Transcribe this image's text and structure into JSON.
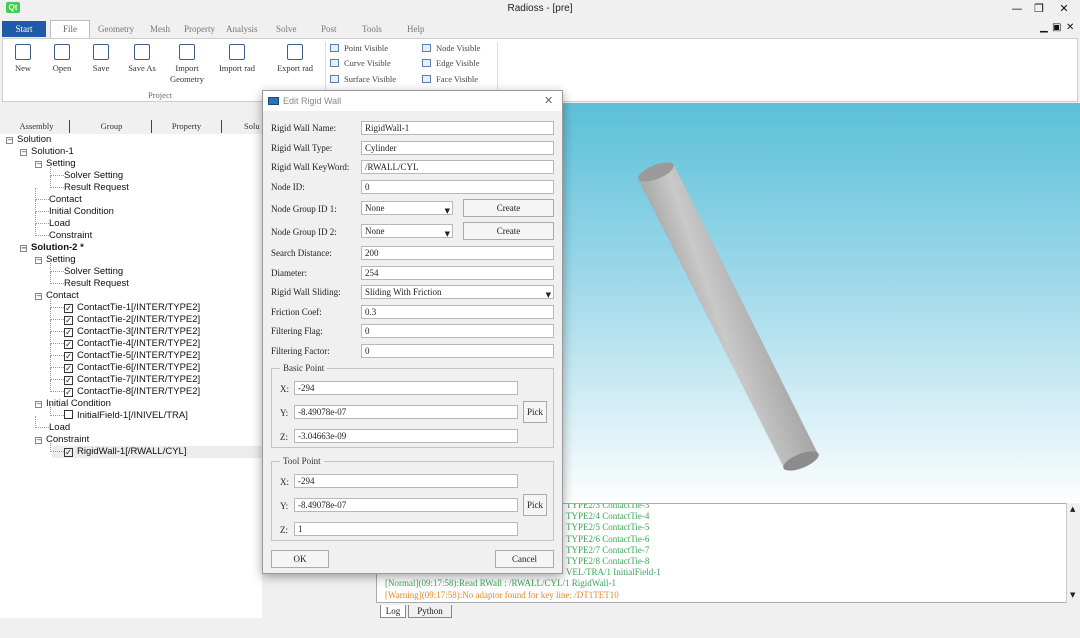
{
  "window": {
    "title": "Radioss - [pre]",
    "qt_logo": "Qt"
  },
  "menu": {
    "start": "Start",
    "file": "File",
    "items": [
      "Geometry",
      "Mesh",
      "Property",
      "Analysis",
      "Solve",
      "Post",
      "Tools",
      "Help"
    ]
  },
  "ribbon": {
    "buttons": [
      {
        "label": "New",
        "icon": "new-file-icon"
      },
      {
        "label": "Open",
        "icon": "folder-open-icon"
      },
      {
        "label": "Save",
        "icon": "save-icon"
      },
      {
        "label": "Save As",
        "icon": "save-as-icon"
      },
      {
        "label": "Import Geometry",
        "icon": "import-geometry-icon"
      },
      {
        "label": "Import rad",
        "icon": "import-rad-icon"
      },
      {
        "label": "Export rad",
        "icon": "export-rad-icon"
      }
    ],
    "group_label": "Project",
    "visibility": [
      "Point Visible",
      "Node Visible",
      "Curve Visible",
      "Edge Visible",
      "Surface Visible",
      "Face Visible"
    ]
  },
  "left_tabs": [
    "Assembly",
    "Group",
    "Property",
    "Solu"
  ],
  "tree": [
    {
      "label": "Solution",
      "level": 0,
      "exp": "−"
    },
    {
      "label": "Solution-1",
      "level": 1,
      "exp": "−"
    },
    {
      "label": "Setting",
      "level": 2,
      "exp": "−"
    },
    {
      "label": "Solver Setting",
      "level": 3
    },
    {
      "label": "Result Request",
      "level": 3
    },
    {
      "label": "Contact",
      "level": 2
    },
    {
      "label": "Initial Condition",
      "level": 2
    },
    {
      "label": "Load",
      "level": 2
    },
    {
      "label": "Constraint",
      "level": 2
    },
    {
      "label": "Solution-2 *",
      "level": 1,
      "exp": "−",
      "bold": true
    },
    {
      "label": "Setting",
      "level": 2,
      "exp": "−"
    },
    {
      "label": "Solver Setting",
      "level": 3
    },
    {
      "label": "Result Request",
      "level": 3
    },
    {
      "label": "Contact",
      "level": 2,
      "exp": "−"
    },
    {
      "label": "ContactTie-1[/INTER/TYPE2]",
      "level": 3,
      "check": true
    },
    {
      "label": "ContactTie-2[/INTER/TYPE2]",
      "level": 3,
      "check": true
    },
    {
      "label": "ContactTie-3[/INTER/TYPE2]",
      "level": 3,
      "check": true
    },
    {
      "label": "ContactTie-4[/INTER/TYPE2]",
      "level": 3,
      "check": true
    },
    {
      "label": "ContactTie-5[/INTER/TYPE2]",
      "level": 3,
      "check": true
    },
    {
      "label": "ContactTie-6[/INTER/TYPE2]",
      "level": 3,
      "check": true
    },
    {
      "label": "ContactTie-7[/INTER/TYPE2]",
      "level": 3,
      "check": true
    },
    {
      "label": "ContactTie-8[/INTER/TYPE2]",
      "level": 3,
      "check": true
    },
    {
      "label": "Initial Condition",
      "level": 2,
      "exp": "−"
    },
    {
      "label": "InitialField-1[/INIVEL/TRA]",
      "level": 3,
      "check": false
    },
    {
      "label": "Load",
      "level": 2
    },
    {
      "label": "Constraint",
      "level": 2,
      "exp": "−"
    },
    {
      "label": "RigidWall-1[/RWALL/CYL]",
      "level": 3,
      "check": true
    }
  ],
  "log": {
    "lines": [
      {
        "text": "TYPE2/3 ContactTie-3",
        "color": "#3aa657"
      },
      {
        "text": "TYPE2/4 ContactTie-4",
        "color": "#3aa657"
      },
      {
        "text": "TYPE2/5 ContactTie-5",
        "color": "#3aa657"
      },
      {
        "text": "TYPE2/6 ContactTie-6",
        "color": "#3aa657"
      },
      {
        "text": "TYPE2/7 ContactTie-7",
        "color": "#3aa657"
      },
      {
        "text": "TYPE2/8 ContactTie-8",
        "color": "#3aa657"
      },
      {
        "text": "VEL/TRA/1 InitialField-1",
        "color": "#3aa657"
      },
      {
        "text": "[Normal](09:17:58):Read RWall : /RWALL/CYL/1 RigidWall-1",
        "color": "#3aa657"
      },
      {
        "text": "[Warning](09:17:58):No adaptor found for key line: /DT1TET10",
        "color": "#e08a1e"
      }
    ],
    "tabs": [
      "Log",
      "Python"
    ]
  },
  "dialog": {
    "title": "Edit Rigid Wall",
    "rigid_wall_name": {
      "label": "Rigid Wall Name:",
      "value": "RigidWall-1"
    },
    "rigid_wall_type": {
      "label": "Rigid Wall Type:",
      "value": "Cylinder"
    },
    "rigid_wall_keyword": {
      "label": "Rigid Wall KeyWord:",
      "value": "/RWALL/CYL"
    },
    "node_id": {
      "label": "Node ID:",
      "value": "0"
    },
    "node_group_1": {
      "label": "Node Group ID 1:",
      "value": "None",
      "button": "Create"
    },
    "node_group_2": {
      "label": "Node Group ID 2:",
      "value": "None",
      "button": "Create"
    },
    "search_distance": {
      "label": "Search Distance:",
      "value": "200"
    },
    "diameter": {
      "label": "Diameter:",
      "value": "254"
    },
    "sliding": {
      "label": "Rigid Wall Sliding:",
      "value": "Sliding With Friction"
    },
    "friction": {
      "label": "Friction Coef:",
      "value": "0.3"
    },
    "filter_flag": {
      "label": "Filtering Flag:",
      "value": "0"
    },
    "filter_factor": {
      "label": "Filtering Factor:",
      "value": "0"
    },
    "basic_point": {
      "title": "Basic Point",
      "x_label": "X:",
      "x": "-294",
      "y_label": "Y:",
      "y": "-8.49078e-07",
      "z_label": "Z:",
      "z": "-3.04663e-09",
      "pick": "Pick"
    },
    "tool_point": {
      "title": "Tool Point",
      "x_label": "X:",
      "x": "-294",
      "y_label": "Y:",
      "y": "-8.49078e-07",
      "z_label": "Z:",
      "z": "1",
      "pick": "Pick"
    },
    "ok": "OK",
    "cancel": "Cancel"
  }
}
